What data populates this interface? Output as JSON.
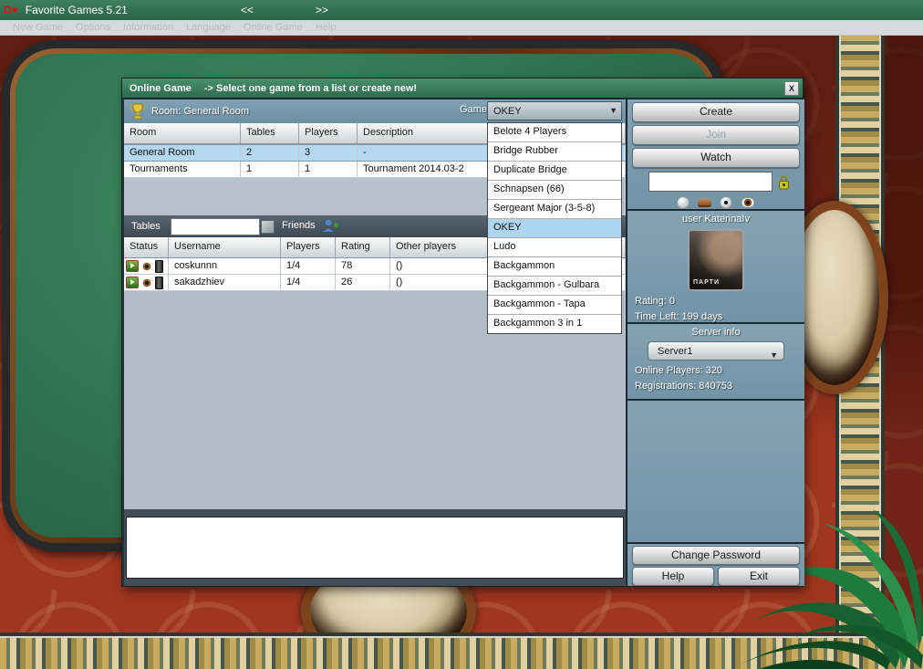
{
  "app": {
    "icon": "D♥",
    "title": "Favorite Games 5.21",
    "nav_back": "<<",
    "nav_forward": ">>",
    "menu": [
      "New Game",
      "Options",
      "Information",
      "Language",
      "Online Game",
      "Help"
    ]
  },
  "dialog": {
    "title": "Online Game",
    "subtitle": "->  Select one game from a list or create new!",
    "close": "X",
    "room_bar": {
      "label": "Room: General Room",
      "game_label": "Game"
    },
    "game_dropdown": {
      "selected": "OKEY",
      "selected_index": 5,
      "options": [
        "Belote 4 Players",
        "Bridge Rubber",
        "Duplicate Bridge",
        "Schnapsen (66)",
        "Sergeant Major (3-5-8)",
        "OKEY",
        "Ludo",
        "Backgammon",
        "Backgammon - Gulbara",
        "Backgammon - Tapa",
        "Backgammon 3 in 1"
      ]
    },
    "room_table": {
      "headers": [
        "Room",
        "Tables",
        "Players",
        "Description"
      ],
      "rows": [
        {
          "room": "General Room",
          "tables": "2",
          "players": "3",
          "description": "-"
        },
        {
          "room": "Tournaments",
          "tables": "1",
          "players": "1",
          "description": "Tournament 2014.03-2"
        }
      ],
      "selected_index": 0
    },
    "filter": {
      "tables_label": "Tables",
      "tables_value": "",
      "friends_label": "Friends"
    },
    "player_table": {
      "headers": [
        "Status",
        "Username",
        "Players",
        "Rating",
        "Other players"
      ],
      "rows": [
        {
          "username": "coskunnn",
          "players": "1/4",
          "rating": "78",
          "other": "()"
        },
        {
          "username": "sakadzhiev",
          "players": "1/4",
          "rating": "26",
          "other": "()"
        }
      ]
    },
    "actions": {
      "create": "Create",
      "join": "Join",
      "watch": "Watch",
      "password_value": ""
    },
    "user_panel": {
      "title": "user KaterinaIv",
      "avatar_caption": "ПАРТИ",
      "rating": "Rating: 0",
      "time_left": "Time Left: 199 days"
    },
    "server_panel": {
      "title": "Server info",
      "selected": "Server1",
      "online_players": "Online Players: 320",
      "registrations": "Registrations: 840753"
    },
    "footer": {
      "change_password": "Change Password",
      "help": "Help",
      "exit": "Exit"
    }
  },
  "colors": {
    "titlebar_green": "#2f7050",
    "dialog_title_green": "#3c8262",
    "panel_steel_blue": "#7b9aab",
    "selection_blue": "#b3d8f0",
    "carpet_red": "#9e3620"
  }
}
